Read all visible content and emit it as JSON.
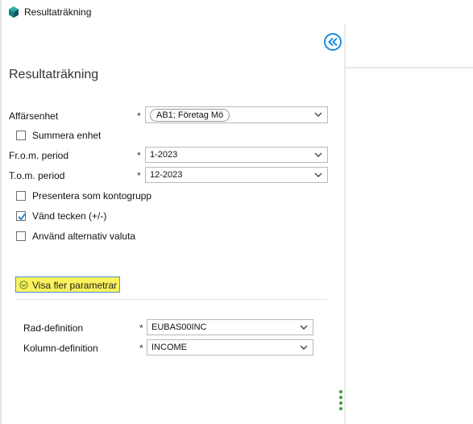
{
  "window": {
    "title": "Resultaträkning"
  },
  "page": {
    "title": "Resultaträkning"
  },
  "fields": {
    "affarsenhet": {
      "label": "Affärsenhet",
      "required": "*",
      "chip": "AB1; Företag Mö"
    },
    "from_period": {
      "label": "Fr.o.m. period",
      "required": "*",
      "value": "1-2023"
    },
    "tom_period": {
      "label": "T.o.m. period",
      "required": "*",
      "value": "12-2023"
    },
    "rad_definition": {
      "label": "Rad-definition",
      "required": "*",
      "value": "EUBAS00INC"
    },
    "kolumn_definition": {
      "label": "Kolumn-definition",
      "required": "*",
      "value": "INCOME"
    }
  },
  "checkboxes": {
    "summera_enhet": {
      "label": "Summera enhet",
      "checked": false
    },
    "presentera_kontogrupp": {
      "label": "Presentera som kontogrupp",
      "checked": false
    },
    "vand_tecken": {
      "label": "Vänd tecken (+/-)",
      "checked": true
    },
    "alternativ_valuta": {
      "label": "Använd alternativ valuta",
      "checked": false
    }
  },
  "more_params": {
    "label": "Visa fler parametrar"
  },
  "icons": {
    "collapse": "double-chevron-left-icon",
    "dropdown": "chevron-down-icon",
    "more": "expand-circle-icon",
    "app": "app-logo-icon",
    "drag": "vertical-dots-icon"
  },
  "colors": {
    "accent": "#1a8fd9",
    "highlight": "#fbf35c",
    "dots": "#3d9b3d"
  }
}
